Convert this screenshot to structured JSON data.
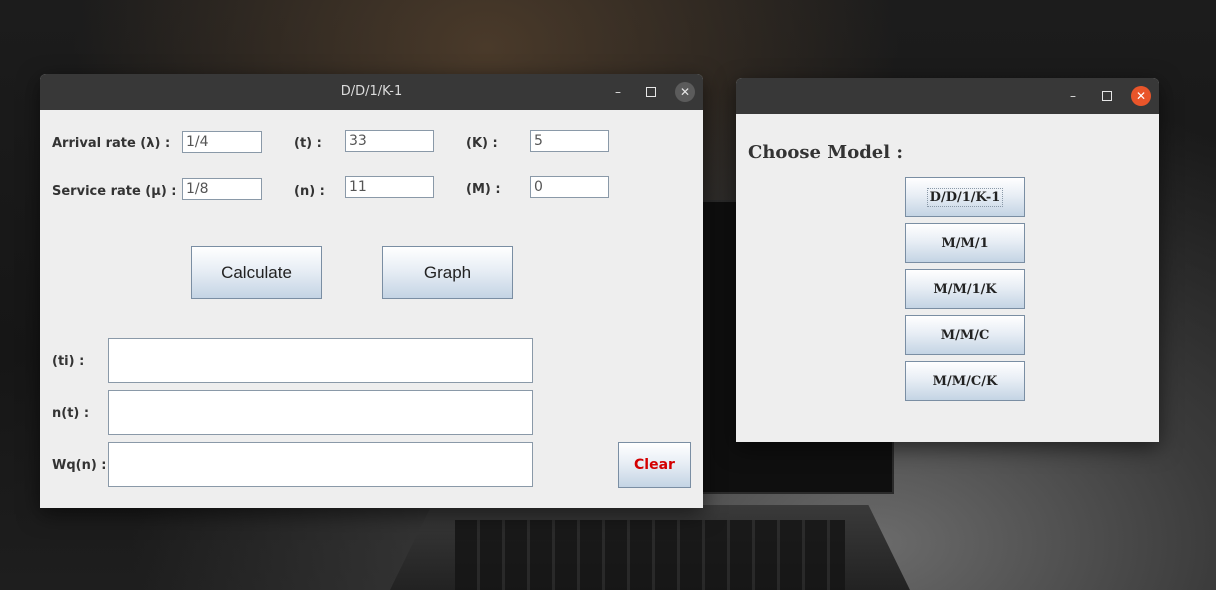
{
  "main_window": {
    "title": "D/D/1/K-1",
    "minimize": "–",
    "inputs": {
      "arrival_rate_label": "Arrival rate (λ)  :",
      "arrival_rate_value": "1/4",
      "service_rate_label": "Service rate (μ) :",
      "service_rate_value": "1/8",
      "t_label": "(t) :",
      "t_value": "33",
      "n_label": "(n) :",
      "n_value": "11",
      "k_label": "(K) :",
      "k_value": "5",
      "m_label": "(M) :",
      "m_value": "0"
    },
    "buttons": {
      "calculate": "Calculate",
      "graph": "Graph",
      "clear": "Clear"
    },
    "outputs": {
      "ti_label": "(ti) :",
      "nt_label": "n(t) :",
      "wq_label": "Wq(n) :"
    }
  },
  "model_window": {
    "minimize": "–",
    "heading": "Choose Model :",
    "models": [
      "D/D/1/K-1",
      "M/M/1",
      "M/M/1/K",
      "M/M/C",
      "M/M/C/K"
    ]
  }
}
